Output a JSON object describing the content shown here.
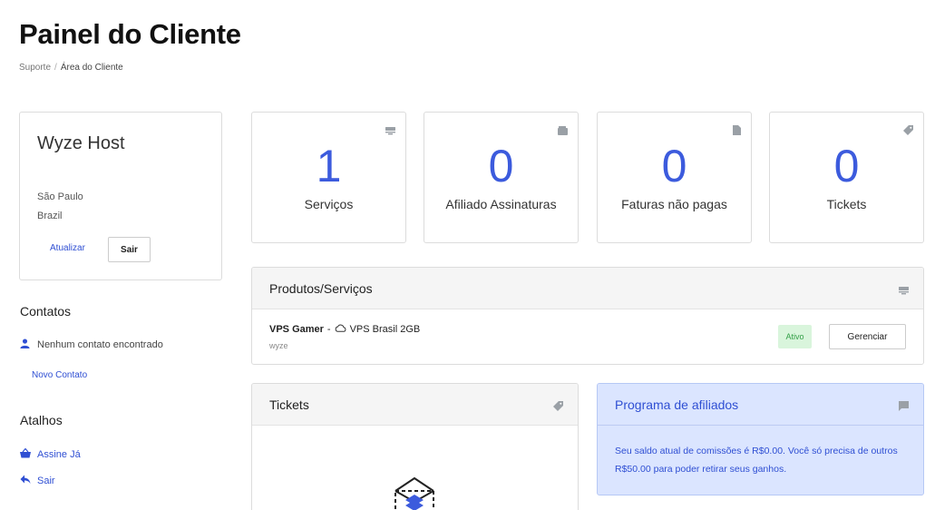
{
  "page": {
    "title": "Painel do Cliente",
    "breadcrumb": {
      "home": "Suporte",
      "separator": "/",
      "current": "Área do Cliente"
    }
  },
  "client": {
    "name": "Wyze Host",
    "city": "São Paulo",
    "country": "Brazil",
    "update_label": "Atualizar",
    "logout_label": "Sair"
  },
  "contacts": {
    "heading": "Contatos",
    "empty_text": "Nenhum contato encontrado",
    "new_label": "Novo Contato"
  },
  "shortcuts": {
    "heading": "Atalhos",
    "items": [
      {
        "label": "Assine Já",
        "icon": "basket-icon"
      },
      {
        "label": "Sair",
        "icon": "back-arrow-icon"
      }
    ]
  },
  "stats": [
    {
      "value": "1",
      "label": "Serviços",
      "icon": "server-icon"
    },
    {
      "value": "0",
      "label": "Afiliado Assinaturas",
      "icon": "wallet-icon"
    },
    {
      "value": "0",
      "label": "Faturas não pagas",
      "icon": "document-icon"
    },
    {
      "value": "0",
      "label": "Tickets",
      "icon": "tag-icon"
    }
  ],
  "products": {
    "title": "Produtos/Serviços",
    "items": [
      {
        "name": "VPS Gamer",
        "separator": "-",
        "plan": "VPS Brasil 2GB",
        "domain": "wyze",
        "status": "Ativo",
        "manage_label": "Gerenciar"
      }
    ]
  },
  "tickets_panel": {
    "title": "Tickets"
  },
  "affiliates": {
    "title": "Programa de afiliados",
    "text": "Seu saldo atual de comissões é R$0.00. Você só precisa de outros R$50.00 para poder retirar seus ganhos."
  },
  "colors": {
    "accent": "#3c5bdd",
    "link": "#2f4fd3",
    "status_active_bg": "#d9f5dc",
    "status_active_text": "#34a048",
    "info_bg": "#dbe5ff"
  }
}
